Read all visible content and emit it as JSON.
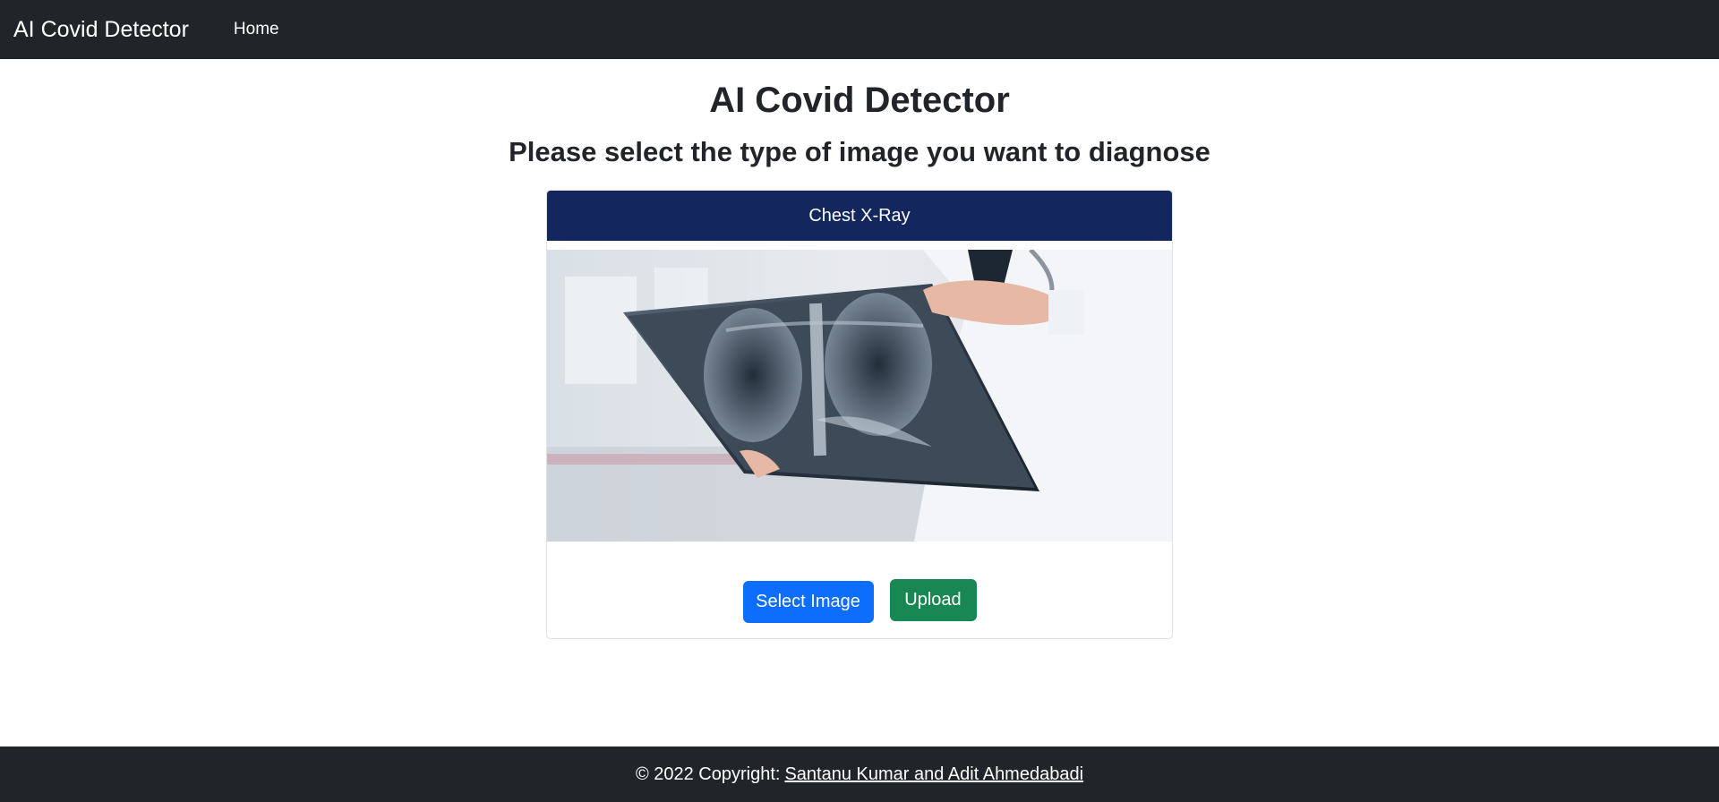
{
  "navbar": {
    "brand": "AI Covid Detector",
    "links": [
      {
        "label": "Home"
      }
    ]
  },
  "main": {
    "title": "AI Covid Detector",
    "subtitle": "Please select the type of image you want to diagnose"
  },
  "card": {
    "header": "Chest X-Ray",
    "image_alt": "doctor-holding-chest-xray",
    "select_button": "Select Image",
    "upload_button": "Upload"
  },
  "footer": {
    "text": "© 2022 Copyright:",
    "link": "Santanu Kumar and Adit Ahmedabadi"
  },
  "colors": {
    "navbar_bg": "#212529",
    "card_header_bg": "#13265e",
    "primary": "#0d6efd",
    "success": "#198754"
  }
}
